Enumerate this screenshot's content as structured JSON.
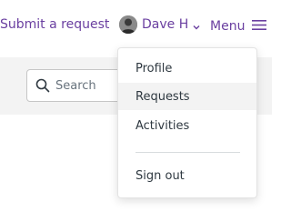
{
  "header": {
    "submit_request_label": "Submit a request",
    "user": {
      "name": "Dave H",
      "avatar_icon": "user-photo-icon"
    },
    "menu_label": "Menu"
  },
  "search": {
    "placeholder": "Search",
    "value": ""
  },
  "user_menu": {
    "items": [
      {
        "label": "Profile"
      },
      {
        "label": "Requests",
        "active": true
      },
      {
        "label": "Activities"
      }
    ],
    "sign_out_label": "Sign out"
  },
  "colors": {
    "link": "#6a3fa0",
    "text": "#2f3941",
    "band": "#f3f3f3",
    "active_item": "#f3f3f3"
  }
}
